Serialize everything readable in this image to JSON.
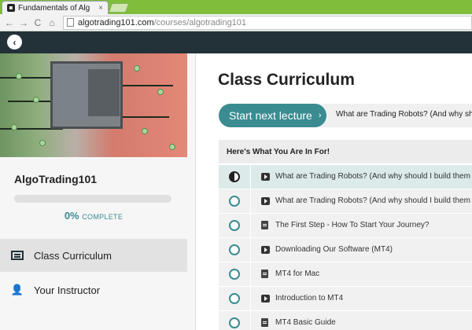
{
  "browser": {
    "tab_title": "Fundamentals of Alg",
    "tab_close": "×",
    "url_host": "algotrading101.com",
    "url_path": "/courses/algotrading101"
  },
  "sidebar": {
    "course_title": "AlgoTrading101",
    "progress_percent": 0,
    "progress_label": "0%",
    "progress_word": "COMPLETE",
    "nav": [
      {
        "label": "Class Curriculum",
        "icon": "list-icon",
        "active": true
      },
      {
        "label": "Your Instructor",
        "icon": "user-icon",
        "active": false
      }
    ]
  },
  "main": {
    "title": "Class Curriculum",
    "start_button": "Start next lecture",
    "start_chevron": "›",
    "next_lecture": "What are Trading Robots? (And why sho",
    "section_title": "Here's What You Are In For!",
    "lectures": [
      {
        "title": "What are Trading Robots? (And why should I build them",
        "type": "video",
        "current": true
      },
      {
        "title": "What are Trading Robots? (And why should I build them",
        "type": "video",
        "current": false
      },
      {
        "title": "The First Step - How To Start Your Journey?",
        "type": "doc",
        "current": false
      },
      {
        "title": "Downloading Our Software (MT4)",
        "type": "video",
        "current": false
      },
      {
        "title": "MT4 for Mac",
        "type": "doc",
        "current": false
      },
      {
        "title": "Introduction to MT4",
        "type": "video",
        "current": false
      },
      {
        "title": "MT4 Basic Guide",
        "type": "doc",
        "current": false
      }
    ]
  },
  "colors": {
    "accent": "#3a8c91",
    "topbar": "#233238",
    "tabstrip": "#7fbd3b"
  }
}
